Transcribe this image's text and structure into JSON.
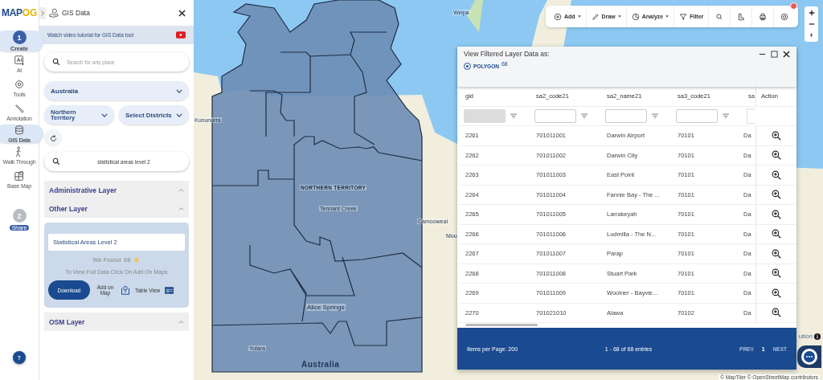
{
  "logo": {
    "part_a": "MAP",
    "part_b": "OG"
  },
  "rail": [
    {
      "kind": "step",
      "number": "1",
      "label": "Create",
      "selected": true
    },
    {
      "kind": "ai",
      "label": "AI",
      "selected": false
    },
    {
      "kind": "tools",
      "label": "Tools",
      "selected": false
    },
    {
      "kind": "annotation",
      "label": "Annotation",
      "selected": false
    },
    {
      "kind": "gis",
      "label": "GIS Data",
      "selected": true
    },
    {
      "kind": "walk",
      "label": "Walk Through",
      "selected": false
    },
    {
      "kind": "basemap",
      "label": "Base Map",
      "selected": false
    },
    {
      "kind": "step",
      "number": "2",
      "label": "Share",
      "selected": false
    }
  ],
  "user": {
    "initial": "T"
  },
  "sidebar": {
    "title": "GIS Data",
    "tutorial": "Watch video tutorial for GIS Data tool",
    "search": {
      "placeholder": "Search for any place"
    },
    "country": "Australia",
    "state": "Northern Territory",
    "district": "Select Districts",
    "layer_search": "statistical areas level 2",
    "sections": [
      {
        "title": "Administrative Layer"
      },
      {
        "title": "Other Layer",
        "result": {
          "layer": "Statistical Areas Level 2",
          "found": "We Found",
          "count": "68",
          "hint": "To View Full Data Click On Add On Maps",
          "download": "Download",
          "add_on_map": "Add on Map",
          "table_view": "Table View"
        }
      },
      {
        "title": "OSM Layer"
      }
    ]
  },
  "toolbar": [
    {
      "kind": "add",
      "label": "Add",
      "dropdown": true
    },
    {
      "kind": "draw",
      "label": "Draw",
      "dropdown": true
    },
    {
      "kind": "analyze",
      "label": "Analyze",
      "dropdown": true
    },
    {
      "kind": "filter",
      "label": "Filter",
      "dropdown": false
    },
    {
      "kind": "search"
    },
    {
      "kind": "measure"
    },
    {
      "kind": "print"
    },
    {
      "kind": "locate",
      "alert": true
    }
  ],
  "map_labels": [
    {
      "kind": "town",
      "text": "Weipa"
    },
    {
      "kind": "town",
      "text": "Kununurra"
    },
    {
      "kind": "region",
      "text": "NORTHERN TERRITORY"
    },
    {
      "kind": "town",
      "text": "Tennant Creek"
    },
    {
      "kind": "town",
      "text": "Camooweal"
    },
    {
      "kind": "town",
      "text": "Mou"
    },
    {
      "kind": "city",
      "text": "Alice Springs"
    },
    {
      "kind": "town",
      "text": "Yulara"
    },
    {
      "kind": "country",
      "text": "Australia"
    }
  ],
  "panel": {
    "title": "View Filtered Layer Data as:",
    "option": {
      "label": "POLYGON",
      "count": "68",
      "selected": true
    },
    "columns": [
      {
        "title": "gid",
        "filter": {
          "disabled": true
        }
      },
      {
        "title": "sa2_code21",
        "filter": {
          "disabled": false
        }
      },
      {
        "title": "sa2_name21",
        "filter": {
          "disabled": false
        }
      },
      {
        "title": "sa3_code21",
        "filter": {
          "disabled": false
        }
      },
      {
        "title": "sa"
      },
      {
        "title": "Action"
      }
    ],
    "rows": [
      [
        "2261",
        "701011001",
        "Darwin Airport",
        "70101",
        "Da"
      ],
      [
        "2262",
        "701011002",
        "Darwin City",
        "70101",
        "Da"
      ],
      [
        "2263",
        "701011003",
        "East Point",
        "70101",
        "Da"
      ],
      [
        "2264",
        "701011004",
        "Fannie Bay - The ...",
        "70101",
        "Da"
      ],
      [
        "2265",
        "701011005",
        "Larrakeyah",
        "70101",
        "Da"
      ],
      [
        "2266",
        "701011006",
        "Ludmilla - The N...",
        "70101",
        "Da"
      ],
      [
        "2267",
        "701011007",
        "Parap",
        "70101",
        "Da"
      ],
      [
        "2268",
        "701011008",
        "Stuart Park",
        "70101",
        "Da"
      ],
      [
        "2269",
        "701011009",
        "Woolner - Bayvie...",
        "70101",
        "Da"
      ],
      [
        "2270",
        "701021010",
        "Alawa",
        "70102",
        "Da"
      ]
    ],
    "footer": {
      "per_page": "Items per Page: 200",
      "range": "1 - 68 of 68 entries",
      "prev": "PREV",
      "page": "1",
      "next": "NEXT"
    }
  },
  "attribution_cut": "ution",
  "attribution": "© MapTiler © OpenStreetMap contributors"
}
